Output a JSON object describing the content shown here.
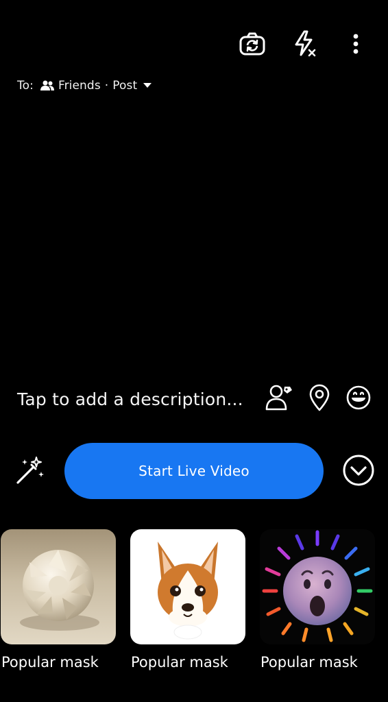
{
  "top_bar": {
    "switch_camera_icon": "camera-switch-icon",
    "flash_icon": "flash-off-icon",
    "more_icon": "more-vertical-icon"
  },
  "audience": {
    "to_label": "To:",
    "friends_label": "Friends",
    "separator": "·",
    "post_label": "Post"
  },
  "description": {
    "placeholder": "Tap to add a description..."
  },
  "actions": {
    "live_button_label": "Start Live Video",
    "accent_color": "#1877f2"
  },
  "masks": [
    {
      "label": "Popular mask",
      "icon": "sphere-mask-icon"
    },
    {
      "label": "Popular mask",
      "icon": "corgi-mask-icon"
    },
    {
      "label": "Popular mask",
      "icon": "surprised-emoji-mask-icon"
    }
  ]
}
